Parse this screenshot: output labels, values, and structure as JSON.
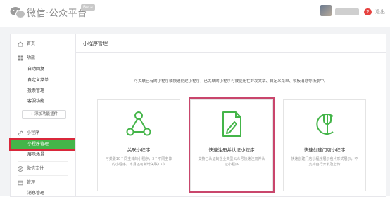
{
  "header": {
    "brand": "微信·公众平台",
    "beta": "Beta",
    "notification_count": "2",
    "more_label": "退出"
  },
  "sidebar": {
    "home": "首页",
    "function": "功能",
    "function_items": [
      "自动回复",
      "自定义菜单",
      "投票管理",
      "客服功能"
    ],
    "add_plugin": "+ 添加功能插件",
    "miniprogram": "小程序",
    "miniprogram_items": [
      "小程序管理",
      "展示场景"
    ],
    "wechat_pay": "微信支付",
    "manage": "管理",
    "manage_items": [
      "消息管理"
    ]
  },
  "main": {
    "title": "小程序管理",
    "intro": "可关联已有的小程序或快速创建小程序，已关联的小程序可被使用在群发文章、自定义菜单、模板消息等场景中。",
    "cards": [
      {
        "title": "关联小程序",
        "desc": "可关联10个同主体的小程序，3个不同主体的小程序。本月还可新增关联13次"
      },
      {
        "title": "快速注册并认证小程序",
        "desc": "支持已认证的企业类型公众号快速注册并认证小程序"
      },
      {
        "title": "快速创建门店小程序",
        "desc": "快速创建门店小程序展示名片形式展示，不支持自行开发及上传"
      }
    ]
  },
  "colors": {
    "accent": "#44b549",
    "highlight": "#c9466c",
    "active_outline": "#d9283b"
  }
}
